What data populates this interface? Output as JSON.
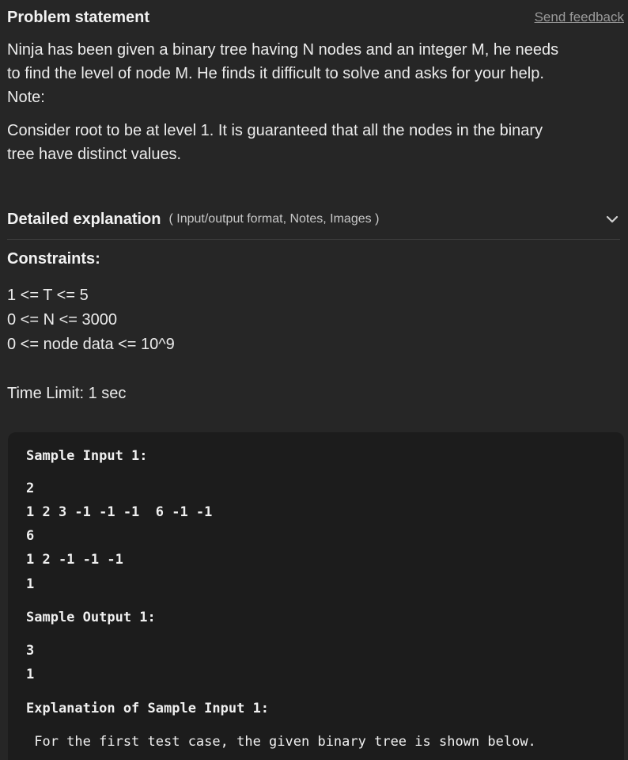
{
  "header": {
    "title": "Problem statement",
    "feedback_label": "Send feedback"
  },
  "statement": {
    "paragraph1_line1": "Ninja has been given a binary tree having N nodes and an integer M, he needs",
    "paragraph1_line2": "to find the level of node M. He finds it difficult to solve and asks for your help.",
    "paragraph1_line3": "Note:",
    "paragraph2_line1": "Consider root to be at level 1. It is guaranteed that all the nodes in the binary",
    "paragraph2_line2": "tree have distinct values."
  },
  "details": {
    "title": "Detailed explanation",
    "subtitle": "( Input/output format, Notes, Images )",
    "icon": "chevron-down-icon"
  },
  "constraints": {
    "title": "Constraints:",
    "items": [
      "1 <= T <= 5",
      "0 <= N <= 3000",
      "0 <= node data <= 10^9"
    ],
    "time_limit": "Time Limit: 1 sec"
  },
  "sample": {
    "input_title": "Sample Input 1:",
    "input_lines": [
      "2",
      "1 2 3 -1 -1 -1  6 -1 -1",
      "6",
      "1 2 -1 -1 -1",
      "1"
    ],
    "output_title": "Sample Output 1:",
    "output_lines": [
      "3",
      "1"
    ],
    "explanation_title": "Explanation of Sample Input 1:",
    "explanation_line": " For the first test case, the given binary tree is shown below."
  },
  "colors": {
    "background": "#262626",
    "sample_background": "#1c1c1c",
    "muted": "#9a9a9a"
  }
}
